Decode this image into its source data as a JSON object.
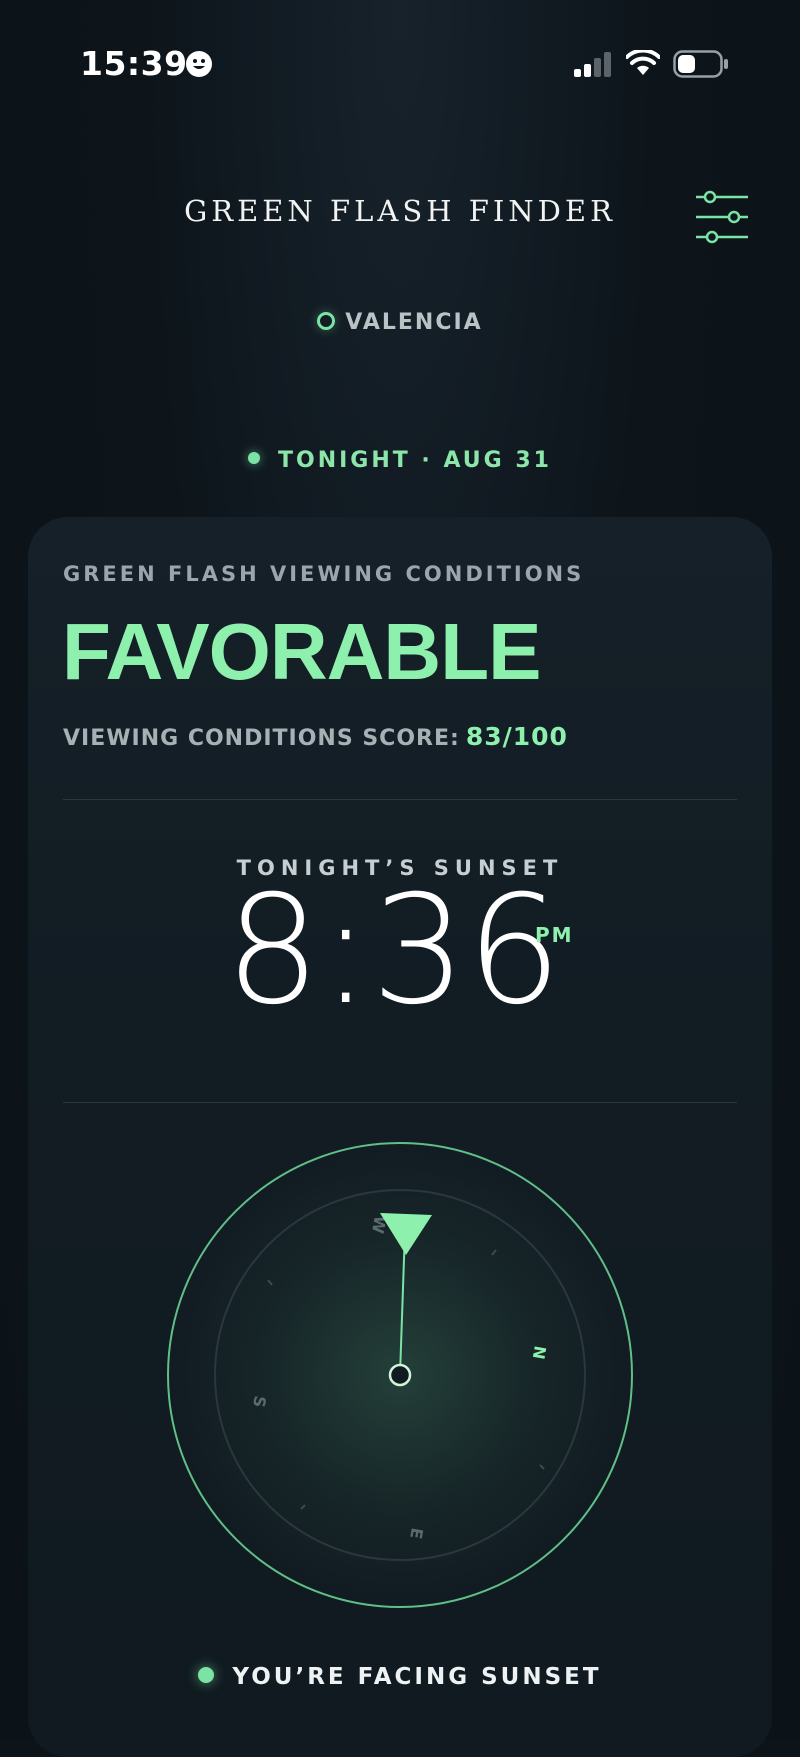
{
  "status_bar": {
    "time": "15:39",
    "icons": [
      "face-icon",
      "signal-icon",
      "wifi-icon",
      "battery-icon"
    ]
  },
  "header": {
    "title": "GREEN FLASH FINDER",
    "menu_icon": "sliders-icon"
  },
  "location": {
    "name": "VALENCIA"
  },
  "date": {
    "label": "TONIGHT · AUG 31"
  },
  "conditions": {
    "label": "GREEN FLASH VIEWING CONDITIONS",
    "value": "FAVORABLE",
    "score_label": "VIEWING CONDITIONS SCORE:",
    "score_value": "83/100"
  },
  "sunset": {
    "label": "TONIGHT’S SUNSET",
    "time": "8:36",
    "ampm": "PM"
  },
  "compass": {
    "cardinals": {
      "n": "N",
      "e": "E",
      "s": "S",
      "w": "W"
    },
    "accent_color": "#7be3a3"
  },
  "facing": {
    "label": "YOU’RE FACING SUNSET"
  },
  "colors": {
    "accent": "#8ef0ad",
    "background": "#0d151b",
    "card": "#131d24"
  }
}
